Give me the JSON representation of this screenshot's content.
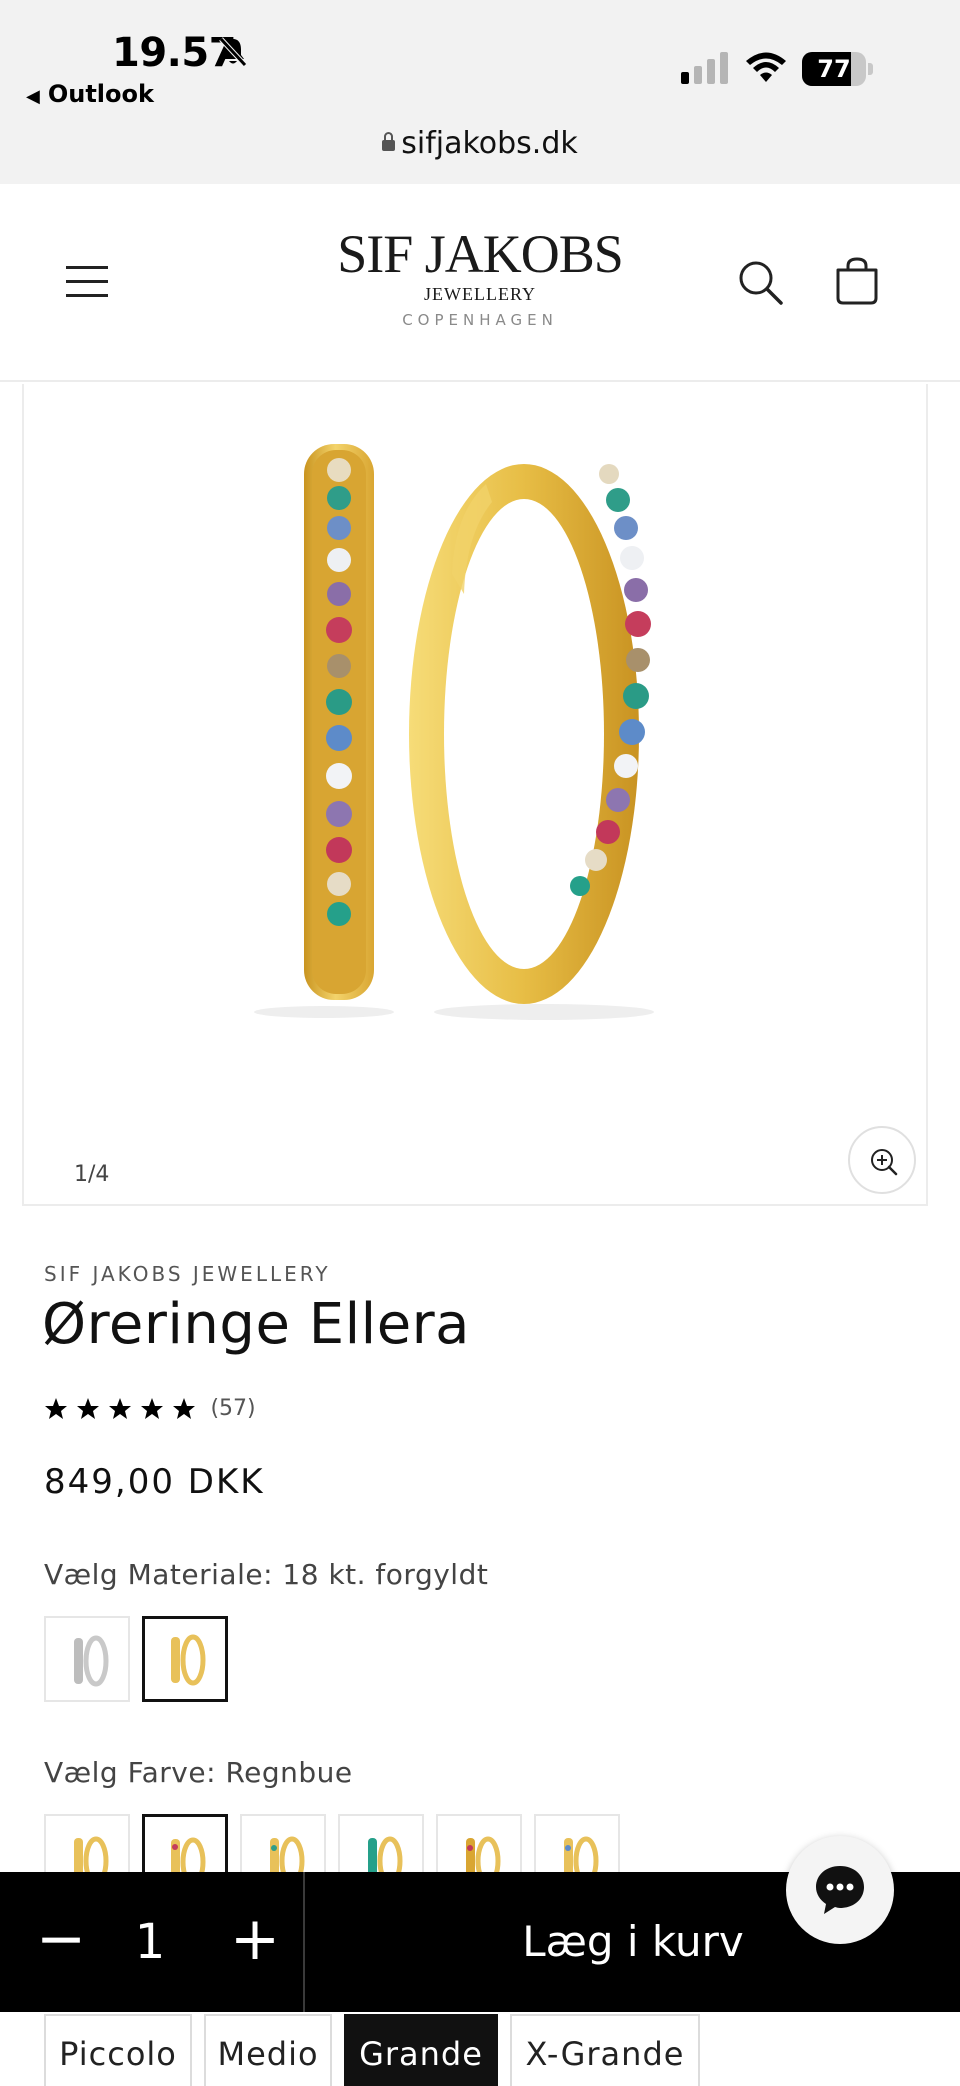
{
  "status_bar": {
    "time": "19.57",
    "back_app": "Outlook",
    "battery": "77",
    "battery_level": 0.77
  },
  "browser": {
    "url": "sifjakobs.dk"
  },
  "header": {
    "logo_main": "SIF JAKOBS",
    "logo_sub": "JEWELLERY",
    "logo_city": "COPENHAGEN",
    "icons": [
      "menu-icon",
      "search-icon",
      "cart-icon"
    ]
  },
  "gallery": {
    "counter": "1/4",
    "zoom_icon": "zoom-in-icon"
  },
  "product": {
    "vendor": "SIF JAKOBS JEWELLERY",
    "title": "Øreringe Ellera",
    "rating": 5,
    "rating_count": "(57)",
    "price": "849,00 DKK",
    "material_label": "Vælg Materiale: 18 kt. forgyldt",
    "color_label": "Vælg Farve: Regnbue",
    "colors": {
      "gold": "#e8c15a",
      "silver": "#c9c9c9",
      "accent": "#000000"
    }
  },
  "cart_bar": {
    "minus": "−",
    "quantity": "1",
    "plus": "+",
    "add_label": "Læg i kurv"
  },
  "sizes": [
    "Piccolo",
    "Medio",
    "Grande",
    "X-Grande"
  ],
  "selected_size": "Grande"
}
